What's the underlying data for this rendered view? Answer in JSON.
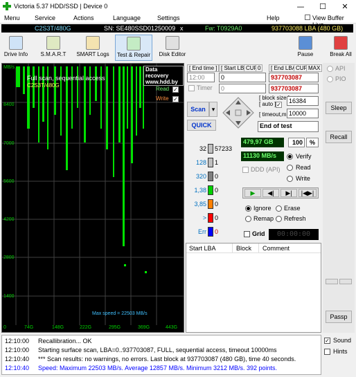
{
  "window": {
    "title": "Victoria 5.37 HDD/SSD | Device 0",
    "min": "—",
    "max": "☐",
    "close": "✕"
  },
  "menu": {
    "items": [
      "Menu",
      "Service",
      "Actions",
      "Language",
      "Settings",
      "Help"
    ],
    "view_buffer": "View Buffer Live"
  },
  "infobar": {
    "model": "C2S3T/480G",
    "serial": "SN: SE480SSD01250009",
    "close": "x",
    "firmware": "Fw: T0929A0",
    "lba": "937703088 LBA (480 GB)"
  },
  "toolbar": {
    "buttons": [
      "Drive Info",
      "S.M.A.R.T",
      "SMART Logs",
      "Test & Repair",
      "Disk Editor"
    ],
    "pause": "Pause",
    "break_all": "Break All"
  },
  "graph": {
    "unit": "MB/s",
    "y_ticks": [
      "9800",
      "8400",
      "7000",
      "5600",
      "4200",
      "2800",
      "1400"
    ],
    "x_ticks": [
      "0",
      "74G",
      "148G",
      "222G",
      "295G",
      "369G",
      "443G"
    ],
    "title": "Full scan, sequential access",
    "model": "C2S3T/480G",
    "data_recovery": "Data recovery",
    "site": "www.hdd.by",
    "read": "Read",
    "write": "Write",
    "max_speed": "Max speed = 22503 MB/s"
  },
  "lba_panel": {
    "end_time": "[ End time ]",
    "start_lba": "[ Start LBA ]",
    "cur": "CUR",
    "zero": "0",
    "end_lba": "[ End LBA ]",
    "max": "MAX",
    "time_val": "12:00",
    "start_val": "0",
    "end_val": "937703087",
    "timer": "Timer",
    "timer_val": "0",
    "end_val2": "937703087"
  },
  "scan": {
    "scan": "Scan",
    "quick": "QUICK",
    "block_size": "[ block size ]",
    "auto": "[ auto ]",
    "bs_val": "16384",
    "timeout": "[ timeout,ms ]",
    "to_val": "10000",
    "end_of_test": "End of test"
  },
  "stats": [
    {
      "label": "32",
      "count": "57233",
      "color": "#c0c0c0"
    },
    {
      "label": "128",
      "count": "1",
      "color": "#c0c0c0"
    },
    {
      "label": "320",
      "count": "0",
      "color": "#808080"
    },
    {
      "label": "1,38",
      "count": "0",
      "color": "#00d000"
    },
    {
      "label": "3,85",
      "count": "0",
      "color": "#ff8000"
    },
    {
      "label": ">",
      "count": "0",
      "color": "#ff0000"
    },
    {
      "label": "Err",
      "count": "0",
      "color": "#0000ff"
    }
  ],
  "progress": {
    "gb": "479,97 GB",
    "pct": "100",
    "pct_unit": "%",
    "speed": "11130 MB/s",
    "ddd": "DDD (API)",
    "verify": "Verify",
    "read": "Read",
    "write": "Write"
  },
  "mode": {
    "ignore": "Ignore",
    "erase": "Erase",
    "remap": "Remap",
    "refresh": "Refresh",
    "grid": "Grid",
    "timer": "00:00:00"
  },
  "table": {
    "cols": [
      "Start LBA",
      "Block",
      "Comment"
    ]
  },
  "side": {
    "api": "API",
    "pio": "PIO",
    "sleep": "Sleep",
    "recall": "Recall",
    "passp": "Passp"
  },
  "log": [
    {
      "time": "12:10:00",
      "msg": "Recallibration... OK",
      "color": "#000"
    },
    {
      "time": "12:10:00",
      "msg": "Starting surface scan, LBA=0..937703087, FULL, sequential access, timeout 10000ms",
      "color": "#000"
    },
    {
      "time": "12:10:40",
      "msg": "*** Scan results: no warnings, no errors. Last block at 937703087 (480 GB), time 40 seconds.",
      "color": "#000"
    },
    {
      "time": "12:10:40",
      "msg": "Speed: Maximum 22503 MB/s. Average 12857 MB/s. Minimum 3212 MB/s. 392 points.",
      "color": "#0000ff"
    }
  ],
  "log_opts": {
    "sound": "Sound",
    "hints": "Hints"
  }
}
